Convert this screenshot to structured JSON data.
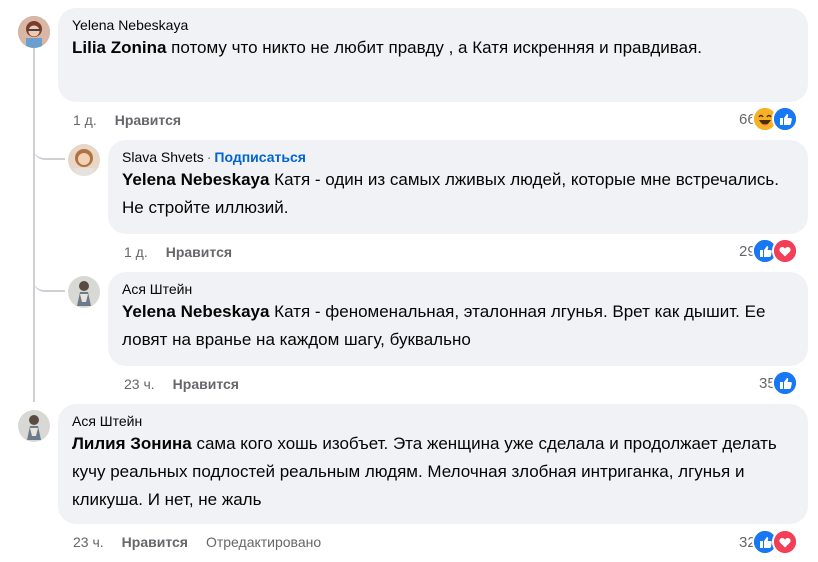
{
  "comments": [
    {
      "author": "Yelena Nebeskaya",
      "mention": "Lilia Zonina",
      "text": " потому что никто не любит правду , а Катя искренняя и правдивая.",
      "time": "1 д.",
      "like_label": "Нравится",
      "reaction_count": "66",
      "reactions": [
        "haha-icon",
        "like-icon"
      ]
    },
    {
      "author": "Slava Shvets",
      "follow_label": "Подписаться",
      "mention": "Yelena Nebeskaya",
      "text": " Катя - один из самых лживых людей, которые мне встречались. Не стройте иллюзий.",
      "time": "1 д.",
      "like_label": "Нравится",
      "reaction_count": "29",
      "reactions": [
        "like-icon",
        "love-icon"
      ]
    },
    {
      "author": "Ася Штейн",
      "mention": "Yelena Nebeskaya",
      "text": " Катя - феноменальная, эталонная лгунья. Врет как дышит. Ее ловят на вранье на каждом шагу, буквально",
      "time": "23 ч.",
      "like_label": "Нравится",
      "reaction_count": "35",
      "reactions": [
        "like-icon"
      ]
    },
    {
      "author": "Ася Штейн",
      "mention": "Лилия Зонина",
      "text": " сама кого хошь изобъет. Эта женщина уже сделала и продолжает делать кучу реальных подлостей реальным людям. Мелочная злобная интриганка, лгунья и кликуша. И нет, не жаль",
      "time": "23 ч.",
      "like_label": "Нравится",
      "edited_label": "Отредактировано",
      "reaction_count": "32",
      "reactions": [
        "like-icon",
        "love-icon"
      ]
    }
  ],
  "colors": {
    "bubble": "#f0f2f5",
    "secondary_text": "#65676b",
    "link": "#0064d1",
    "like": "#1877f2",
    "love": "#f33e58",
    "haha": "#f7b125"
  }
}
